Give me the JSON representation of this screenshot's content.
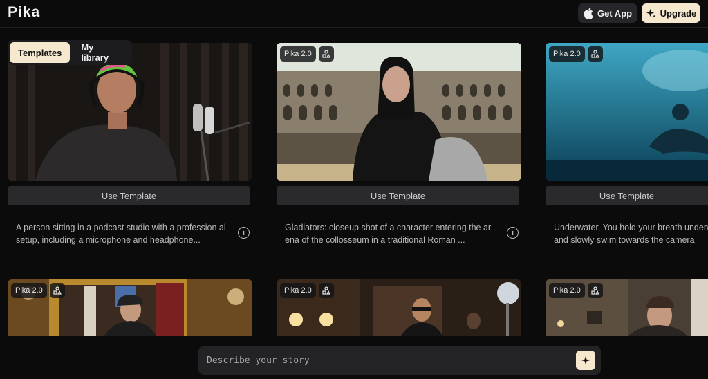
{
  "header": {
    "logo": "Pika",
    "get_app_label": "Get App",
    "upgrade_label": "Upgrade"
  },
  "tabs": [
    {
      "label": "Templates",
      "active": true
    },
    {
      "label": "My library",
      "active": false
    }
  ],
  "cards": [
    {
      "version": "",
      "button": "Use Template",
      "description": "A person sitting in a podcast studio with a profession al setup, including a microphone and headphone..."
    },
    {
      "version": "Pika 2.0",
      "button": "Use Template",
      "description": "Gladiators: closeup shot of a character entering the arena of the collosseum in a traditional Roman ..."
    },
    {
      "version": "Pika 2.0",
      "button": "Use Template",
      "description": "Underwater, You hold your breath underwater and slowly swim towards the camera"
    },
    {
      "version": "Pika 2.0"
    },
    {
      "version": "Pika 2.0"
    },
    {
      "version": "Pika 2.0"
    }
  ],
  "prompt": {
    "placeholder": "Describe your story"
  },
  "icons": {
    "apple": "apple-icon",
    "sparkle": "sparkle-icon",
    "shapes": "shapes-icon",
    "info": "info-icon"
  },
  "colors": {
    "accent": "#f6e7cf",
    "background": "#0b0b0c"
  }
}
